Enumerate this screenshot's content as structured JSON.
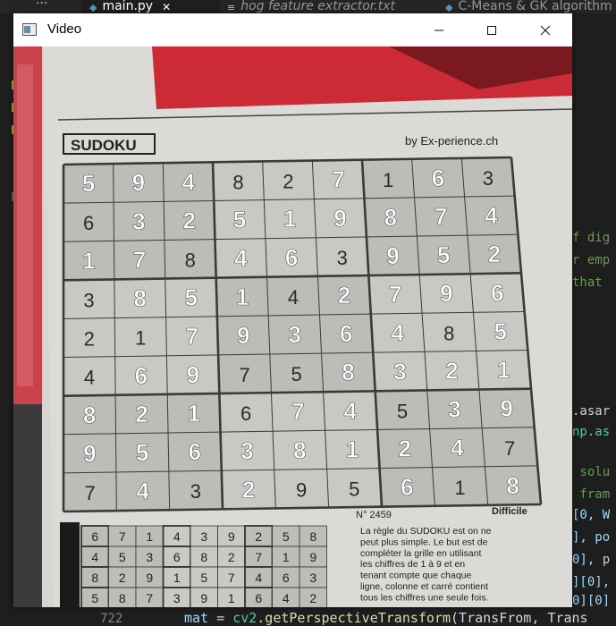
{
  "editor": {
    "tabs": [
      {
        "label": "main.py",
        "active": true,
        "icon": "python-file-icon"
      },
      {
        "label": "hog feature extractor.txt",
        "active": false,
        "icon": "text-file-icon"
      },
      {
        "label": "C-Means & GK algorithm",
        "active": false,
        "icon": "python-file-icon"
      }
    ],
    "more_label": "···",
    "close_glyph": "✕",
    "code_fragments": [
      {
        "text": "f dig",
        "color": "#6a9955"
      },
      {
        "text": "r emp",
        "color": "#6a9955"
      },
      {
        "text": "that",
        "color": "#6a9955"
      },
      {
        "text": ".asar",
        "color": "#d4d4d4"
      },
      {
        "text": "np.as",
        "color": "#4ec9b0"
      },
      {
        "text": " solu",
        "color": "#6a9955"
      },
      {
        "text": " fram",
        "color": "#6a9955"
      },
      {
        "text": "[0, W",
        "color": "#9cdcfe"
      },
      {
        "text": "], po",
        "color": "#9cdcfe"
      },
      {
        "text": "0], p",
        "color": "#9cdcfe"
      },
      {
        "text": "][0],",
        "color": "#9cdcfe"
      },
      {
        "text": "0][0]",
        "color": "#9cdcfe"
      }
    ],
    "line_number": "722",
    "code_line": {
      "var": "mat",
      "op": " = ",
      "module": "cv2",
      "func": ".getPerspectiveTransform",
      "args": "(TransFrom, Trans"
    }
  },
  "window": {
    "title": "Video",
    "minimize_glyph": "—",
    "close_glyph": "✕"
  },
  "paper": {
    "heading": "SUDOKU",
    "byline": "by Ex-perience.ch",
    "grid": [
      [
        5,
        9,
        4,
        8,
        2,
        7,
        1,
        6,
        3
      ],
      [
        6,
        3,
        2,
        5,
        1,
        9,
        8,
        7,
        4
      ],
      [
        1,
        7,
        8,
        4,
        6,
        3,
        9,
        5,
        2
      ],
      [
        3,
        8,
        5,
        1,
        4,
        2,
        7,
        9,
        6
      ],
      [
        2,
        1,
        7,
        9,
        3,
        6,
        4,
        8,
        5
      ],
      [
        4,
        6,
        9,
        7,
        5,
        8,
        3,
        2,
        1
      ],
      [
        8,
        2,
        1,
        6,
        7,
        4,
        5,
        3,
        9
      ],
      [
        9,
        5,
        6,
        3,
        8,
        1,
        2,
        4,
        7
      ],
      [
        7,
        4,
        3,
        2,
        9,
        5,
        6,
        1,
        8
      ]
    ],
    "solved_cells": [
      [
        1,
        1,
        1,
        0,
        0,
        1,
        0,
        1,
        0
      ],
      [
        0,
        1,
        1,
        1,
        1,
        1,
        1,
        1,
        1
      ],
      [
        1,
        1,
        0,
        1,
        1,
        0,
        1,
        1,
        1
      ],
      [
        0,
        1,
        1,
        1,
        0,
        1,
        1,
        1,
        1
      ],
      [
        0,
        0,
        1,
        1,
        1,
        1,
        1,
        0,
        1
      ],
      [
        0,
        1,
        1,
        0,
        0,
        1,
        1,
        1,
        1
      ],
      [
        1,
        1,
        1,
        0,
        1,
        1,
        0,
        1,
        1
      ],
      [
        1,
        1,
        1,
        1,
        1,
        1,
        1,
        1,
        0
      ],
      [
        0,
        1,
        0,
        1,
        0,
        0,
        1,
        0,
        1
      ]
    ],
    "puzzle_number": "N° 2459",
    "difficulty": "Difficile",
    "rules_text": [
      "La règle du SUDOKU est on ne",
      "peut plus simple. Le but est de",
      "compléter la grille en utilisant",
      "les chiffres de 1 à 9 et en",
      "tenant compte que chaque",
      "ligne, colonne et carré contient",
      "tous les chiffres une seule fois."
    ],
    "mini_grid": [
      [
        6,
        7,
        1,
        4,
        3,
        9,
        2,
        5,
        8
      ],
      [
        4,
        5,
        3,
        6,
        8,
        2,
        7,
        1,
        9
      ],
      [
        8,
        2,
        9,
        1,
        5,
        7,
        4,
        6,
        3
      ],
      [
        5,
        8,
        7,
        3,
        9,
        1,
        6,
        4,
        2
      ]
    ]
  },
  "colors": {
    "editor_bg": "#1e1e1e",
    "paper": "#d9d8d4",
    "grid_line": "#3a3a3a",
    "solved_digit": "#ffffff",
    "print_digit": "#2b2b2b"
  }
}
